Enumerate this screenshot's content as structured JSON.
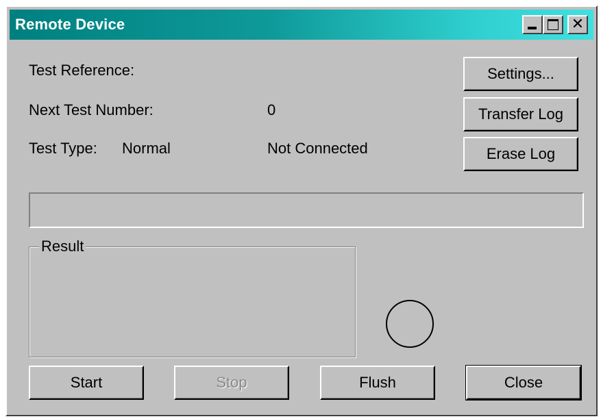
{
  "window": {
    "title": "Remote Device",
    "controls": {
      "minimize_icon": "minimize-icon",
      "maximize_icon": "maximize-icon",
      "close_icon": "close-icon",
      "close_glyph": "✕"
    }
  },
  "fields": {
    "test_reference_label": "Test Reference:",
    "test_reference_value": "",
    "next_test_number_label": "Next Test Number:",
    "next_test_number_value": "0",
    "test_type_label": "Test Type:",
    "test_type_value": "Normal",
    "connection_status": "Not Connected"
  },
  "side_buttons": {
    "settings": "Settings...",
    "transfer_log": "Transfer Log",
    "erase_log": "Erase Log"
  },
  "progress": {
    "value": 0
  },
  "result": {
    "label": "Result",
    "content": ""
  },
  "bottom_buttons": {
    "start": "Start",
    "stop": "Stop",
    "flush": "Flush",
    "close": "Close"
  },
  "colors": {
    "face": "#c0c0c0",
    "title_gradient_start": "#008080",
    "title_gradient_end": "#40e0e0",
    "disabled_text": "#8a8a8a"
  }
}
